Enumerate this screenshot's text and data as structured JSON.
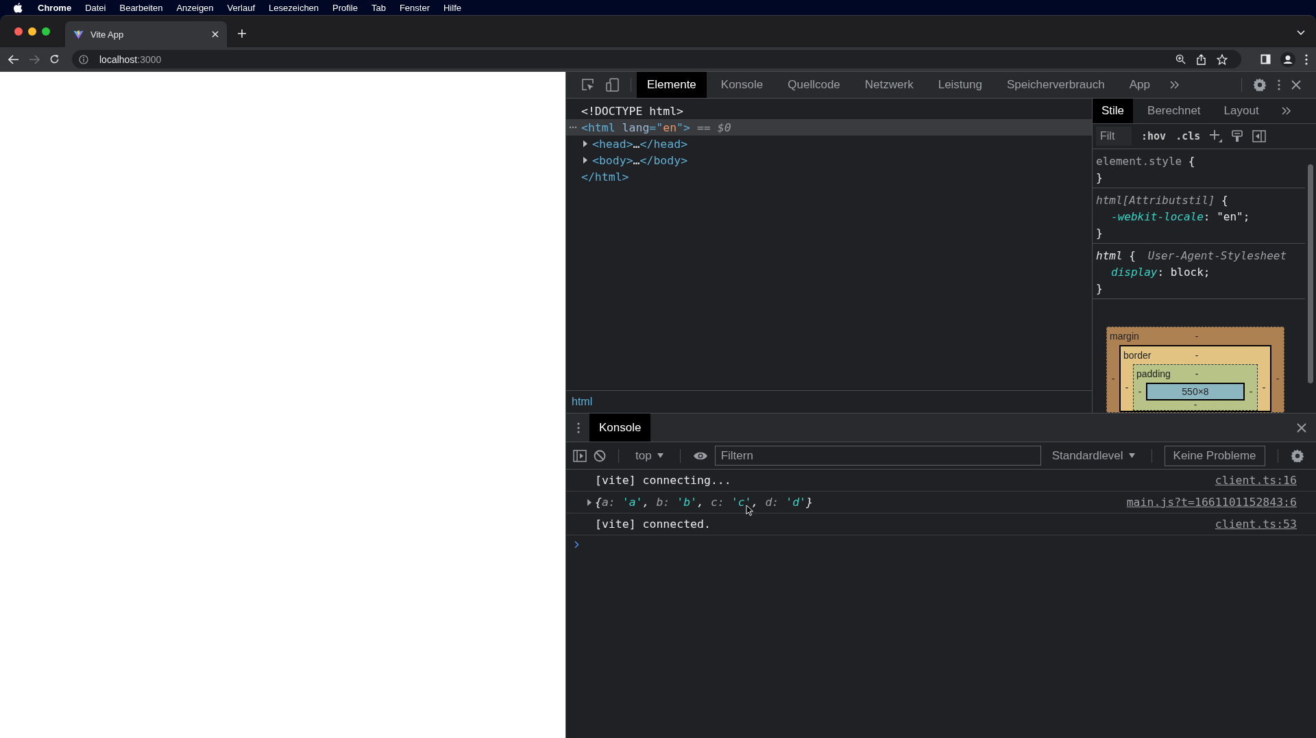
{
  "menu_bar": {
    "app": "Chrome",
    "items": [
      "Datei",
      "Bearbeiten",
      "Anzeigen",
      "Verlauf",
      "Lesezeichen",
      "Profile",
      "Tab",
      "Fenster",
      "Hilfe"
    ]
  },
  "browser_tabs": [
    {
      "title": "Vite App",
      "selected": true
    }
  ],
  "navigation": {
    "back": {
      "disabled": false
    },
    "forward": {
      "disabled": true
    }
  },
  "address_bar": {
    "host": "localhost",
    "port": ":3000"
  },
  "devtools": {
    "tabs": [
      {
        "label": "Elemente",
        "selected": true
      },
      {
        "label": "Konsole",
        "selected": false
      },
      {
        "label": "Quellcode",
        "selected": false
      },
      {
        "label": "Netzwerk",
        "selected": false
      },
      {
        "label": "Leistung",
        "selected": false
      },
      {
        "label": "Speicherverbrauch",
        "selected": false
      },
      {
        "label": "App",
        "selected": false
      }
    ],
    "dom_tree": [
      {
        "parts": [
          {
            "text": "<!DOCTYPE html>",
            "kind": "plain"
          }
        ],
        "selected": false
      },
      {
        "parts": [
          {
            "text": "<html ",
            "kind": "tag"
          },
          {
            "text": "lang",
            "kind": "attr"
          },
          {
            "text": "=\"",
            "kind": "tag"
          },
          {
            "text": "en",
            "kind": "value"
          },
          {
            "text": "\">",
            "kind": "tag"
          },
          {
            "text": " == $0",
            "kind": "ref"
          }
        ],
        "selected": true,
        "children": [
          {
            "parts": [
              {
                "text": "<head>",
                "kind": "tag"
              },
              {
                "text": "…",
                "kind": "plain"
              },
              {
                "text": "</head>",
                "kind": "tag"
              }
            ],
            "selected": false,
            "expanded": false
          },
          {
            "parts": [
              {
                "text": "<body>",
                "kind": "tag"
              },
              {
                "text": "…",
                "kind": "plain"
              },
              {
                "text": "</body>",
                "kind": "tag"
              }
            ],
            "selected": false,
            "expanded": false
          }
        ]
      },
      {
        "parts": [
          {
            "text": "</html>",
            "kind": "tag"
          }
        ],
        "selected": false
      }
    ],
    "breadcrumb": "html",
    "styles": {
      "tabs": [
        {
          "label": "Stile",
          "selected": true
        },
        {
          "label": "Berechnet",
          "selected": false
        },
        {
          "label": "Layout",
          "selected": false
        }
      ],
      "filter_placeholder": "Filt",
      "hov": ":hov",
      "cls": ".cls",
      "rules": [
        {
          "selector": [
            {
              "text": "element.style",
              "kind": "dim"
            },
            {
              "text": " {",
              "kind": "plain"
            }
          ],
          "close": "}"
        },
        {
          "selector": [
            {
              "text": "html[Attributstil]",
              "kind": "dim-italic"
            },
            {
              "text": " {",
              "kind": "plain"
            }
          ],
          "declarations": [
            [
              {
                "text": "-webkit-locale",
                "kind": "prop"
              },
              {
                "text": ": \"en\";",
                "kind": "plain"
              }
            ]
          ],
          "close": "}"
        },
        {
          "selector": [
            {
              "text": "html",
              "kind": "plain"
            },
            {
              "text": " {",
              "kind": "plain"
            }
          ],
          "source": "User-Agent-Stylesheet",
          "declarations": [
            [
              {
                "text": "display",
                "kind": "prop"
              },
              {
                "text": ": block;",
                "kind": "plain"
              }
            ]
          ],
          "close": "}"
        }
      ],
      "box_model": {
        "margin": {
          "label": "margin",
          "top": "-",
          "left": "-",
          "right": "-"
        },
        "border": {
          "label": "border",
          "top": "-",
          "left": "-",
          "right": "-"
        },
        "padding": {
          "label": "padding",
          "top": "-",
          "left": "-",
          "right": "-",
          "bottom": "-"
        },
        "content": "550×8"
      }
    },
    "drawer": {
      "tabs": [
        {
          "label": "Konsole",
          "selected": true
        }
      ],
      "context": "top",
      "filter_placeholder": "Filtern",
      "level": "Standardlevel",
      "issues": "Keine Probleme",
      "messages": [
        {
          "kind": "log",
          "parts": [
            {
              "text": "[vite] connecting...",
              "kind": "plain"
            }
          ],
          "source": "client.ts:16"
        },
        {
          "kind": "object",
          "parts": [
            {
              "text": "{",
              "kind": "plain"
            },
            {
              "text": "a: ",
              "kind": "key"
            },
            {
              "text": "'a'",
              "kind": "string"
            },
            {
              "text": ", ",
              "kind": "plain"
            },
            {
              "text": "b: ",
              "kind": "key"
            },
            {
              "text": "'b'",
              "kind": "string"
            },
            {
              "text": ", ",
              "kind": "plain"
            },
            {
              "text": "c: ",
              "kind": "key"
            },
            {
              "text": "'c'",
              "kind": "string"
            },
            {
              "text": ", ",
              "kind": "plain"
            },
            {
              "text": "d: ",
              "kind": "key"
            },
            {
              "text": "'d'",
              "kind": "string"
            },
            {
              "text": "}",
              "kind": "plain"
            }
          ],
          "source": "main.js?t=1661101152843:6"
        },
        {
          "kind": "log",
          "parts": [
            {
              "text": "[vite] connected.",
              "kind": "plain"
            }
          ],
          "source": "client.ts:53"
        }
      ]
    }
  }
}
